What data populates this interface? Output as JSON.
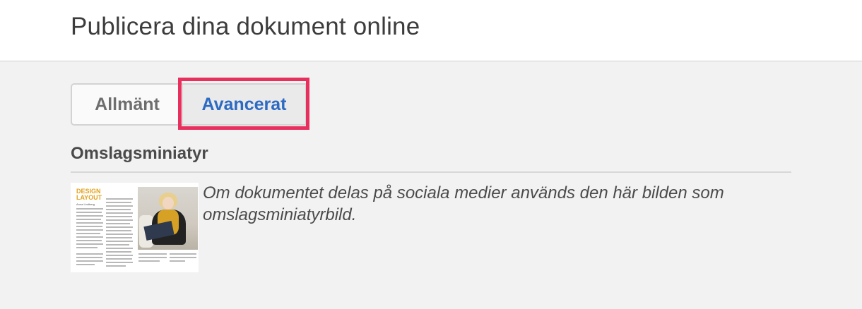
{
  "header": {
    "title": "Publicera dina dokument online"
  },
  "tabs": [
    {
      "label": "Allmänt",
      "selected": false
    },
    {
      "label": "Avancerat",
      "selected": true
    }
  ],
  "section": {
    "title": "Omslagsminiatyr",
    "description": "Om dokumentet delas på sociala medier används den här bilden som omslagsminiatyrbild."
  },
  "thumbnail": {
    "logo_line1": "DESIGN",
    "logo_line2": "LAYOUT",
    "byline": "Anna Lindberg"
  },
  "colors": {
    "active_tab_text": "#2c6ac3",
    "highlight": "#e8305f",
    "logo_accent": "#e2a21c"
  }
}
